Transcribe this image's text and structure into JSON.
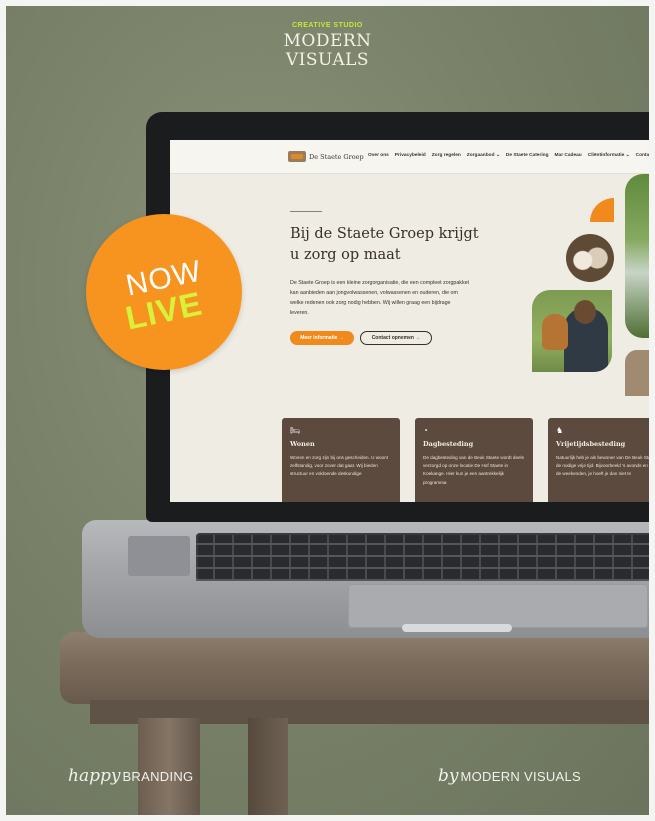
{
  "brand": {
    "kicker": "CREATIVE STUDIO",
    "line1": "MODERN",
    "line2": "VISUALS"
  },
  "badge": {
    "now": "NOW",
    "live": "LIVE"
  },
  "colors": {
    "badge": "#f7941f",
    "badge_live": "#d6f23a",
    "accent_orange": "#f08a1c",
    "card_brown": "#5b4a3d"
  },
  "website": {
    "logo_text": "De Staete Groep",
    "menu": [
      "Over ons",
      "Privacybeleid",
      "Zorg regelen",
      "Zorgaanbod ⌄",
      "De Staete Catering",
      "Mar Cadeau",
      "Cliëntinformatie ⌄",
      "Contact"
    ],
    "hero": {
      "title": "Bij de Staete Groep krijgt u zorg op maat",
      "text": "De Staete Groep is een kleine zorgorganisatie, die een compleet zorgpakket kan aanbieden aan jongvolwassenen, volwassenen en ouderen, die om welke redenen ook zorg nodig hebben. Wij willen graag een bijdrage leveren.",
      "primary_button": "Meer informatie →",
      "secondary_button": "Contact opnemen →"
    },
    "cards": [
      {
        "icon": "bed-icon",
        "glyph": "🛏",
        "title": "Wonen",
        "text": "Wonen en zorg zijn bij ons gescheiden. U woont zelfstandig, voor zover dat gaat. Wij bieden structuur en voldoende deskundige"
      },
      {
        "icon": "clock-icon",
        "glyph": "◔",
        "title": "Dagbesteding",
        "text": "De dagbesteding van de Beuk Staete wordt deels verzorgd op onze locatie De Hof Staete in Koekange. Hier kun je een aantrekkelijk programma"
      },
      {
        "icon": "horse-icon",
        "glyph": "♞",
        "title": "Vrijetijdsbesteding",
        "text": "Natuurlijk heb je als bewoner van De Beuk Staete de nodige vrije tijd. Bijvoorbeeld 's avonds en in de weekenden, je hoeft je dan niet te"
      }
    ]
  },
  "footer": {
    "left": {
      "script": "happy",
      "caps": "BRANDING"
    },
    "right": {
      "script": "by",
      "caps": "MODERN VISUALS"
    }
  }
}
